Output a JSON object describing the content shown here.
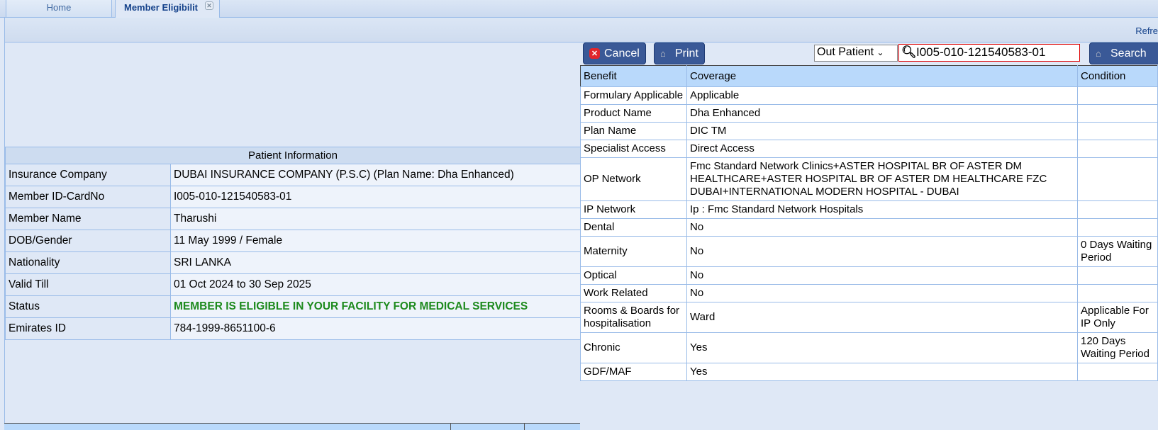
{
  "tabs": {
    "home": "Home",
    "active": "Member Eligibilit"
  },
  "toolbar": {
    "refresh": "Refre"
  },
  "patient": {
    "title": "Patient Information",
    "rows": [
      {
        "label": "Insurance Company",
        "value": "DUBAI INSURANCE COMPANY (P.S.C) (Plan Name: Dha Enhanced)"
      },
      {
        "label": "Member ID-CardNo",
        "value": "I005-010-121540583-01"
      },
      {
        "label": "Member Name",
        "value": "Tharushi"
      },
      {
        "label": "DOB/Gender",
        "value": "11 May 1999 / Female"
      },
      {
        "label": "Nationality",
        "value": "SRI LANKA"
      },
      {
        "label": "Valid Till",
        "value": "01 Oct 2024 to 30 Sep 2025"
      },
      {
        "label": "Status",
        "value": "MEMBER IS ELIGIBLE IN YOUR FACILITY FOR MEDICAL SERVICES"
      },
      {
        "label": "Emirates ID",
        "value": "784-1999-8651100-6"
      }
    ]
  },
  "actions": {
    "cancel": "Cancel",
    "print": "Print",
    "search": "Search",
    "patient_type": "Out Patient",
    "search_value": "I005-010-121540583-01"
  },
  "benefits": {
    "headers": [
      "Benefit",
      "Coverage",
      "Condition"
    ],
    "rows": [
      [
        "Formulary Applicable",
        "Applicable",
        ""
      ],
      [
        "Product Name",
        "Dha Enhanced",
        ""
      ],
      [
        "Plan Name",
        "DIC TM",
        ""
      ],
      [
        "Specialist Access",
        "Direct Access",
        ""
      ],
      [
        "OP Network",
        "Fmc Standard Network Clinics+ASTER HOSPITAL BR OF ASTER DM HEALTHCARE+ASTER HOSPITAL BR OF ASTER DM HEALTHCARE FZC DUBAI+INTERNATIONAL MODERN HOSPITAL - DUBAI",
        ""
      ],
      [
        "IP Network",
        "Ip : Fmc Standard Network Hospitals",
        ""
      ],
      [
        "Dental",
        "No",
        ""
      ],
      [
        "Maternity",
        "No",
        "0 Days Waiting Period"
      ],
      [
        "Optical",
        "No",
        ""
      ],
      [
        "Work Related",
        "No",
        ""
      ],
      [
        "Rooms & Boards for hospitalisation",
        "Ward",
        "Applicable For IP Only"
      ],
      [
        "Chronic",
        "Yes",
        "120 Days Waiting Period"
      ],
      [
        "GDF/MAF",
        "Yes",
        ""
      ]
    ]
  }
}
